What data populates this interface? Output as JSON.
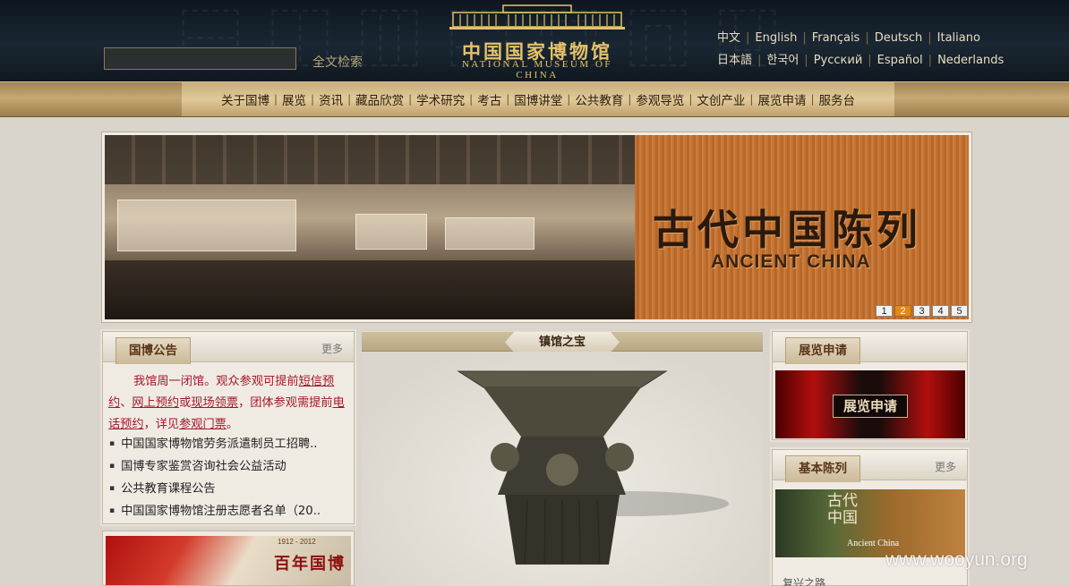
{
  "header": {
    "search_placeholder": "",
    "search_button": "全文检索",
    "logo_cn": "中国国家博物馆",
    "logo_en": "NATIONAL MUSEUM OF CHINA",
    "languages_row1": [
      "中文",
      "English",
      "Français",
      "Deutsch",
      "Italiano"
    ],
    "languages_row2": [
      "日本語",
      "한국어",
      "Русский",
      "Español",
      "Nederlands"
    ]
  },
  "nav": {
    "items": [
      "关于国博",
      "展览",
      "资讯",
      "藏品欣赏",
      "学术研究",
      "考古",
      "国博讲堂",
      "公共教育",
      "参观导览",
      "文创产业",
      "展览申请",
      "服务台"
    ]
  },
  "banner": {
    "title": "古代中国陈列",
    "subtitle": "ANCIENT CHINA",
    "pages": [
      "1",
      "2",
      "3",
      "4",
      "5"
    ],
    "active_page": "2",
    "active_color": "#e08a1a"
  },
  "notice": {
    "title": "国博公告",
    "more": "更多",
    "text_parts": {
      "p1": "我馆周一闭馆。观众参观可提前",
      "link1": "短信预约",
      "p2": "、",
      "link2": "网上预约",
      "p3": "或",
      "link3": "现场领票",
      "p4": "，团体参观需提前",
      "link4": "电话预约",
      "p5": "，详见",
      "link5": "参观门票",
      "p6": "。"
    },
    "items": [
      "中国国家博物馆劳务派遣制员工招聘..",
      "国博专家鉴赏咨询社会公益活动",
      "公共教育课程公告",
      "中国国家博物馆注册志愿者名单（20.."
    ]
  },
  "treasure": {
    "title": "镇馆之宝"
  },
  "apply": {
    "title": "展览申请",
    "image_label": "展览申请"
  },
  "exhibits": {
    "title": "基本陈列",
    "more": "更多",
    "image_cn": "古代中国",
    "image_en": "Ancient China",
    "caption": "复兴之路"
  },
  "century": {
    "years": "1912 - 2012",
    "title": "百年国博"
  },
  "watermark": "www.wooyun.org"
}
